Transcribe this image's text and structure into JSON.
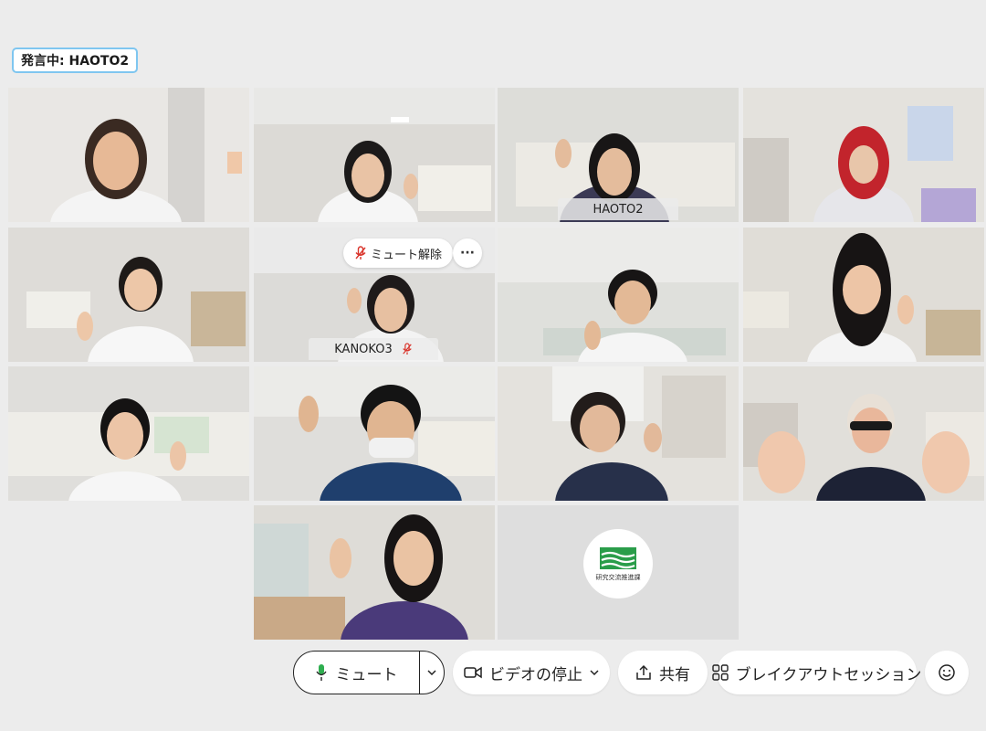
{
  "speaking_indicator": "発言中: HAOTO2",
  "participants": [
    {
      "id": "p1",
      "name": ""
    },
    {
      "id": "p2",
      "name": ""
    },
    {
      "id": "p3",
      "name": "HAOTO2",
      "active_speaker": true
    },
    {
      "id": "p4",
      "name": ""
    },
    {
      "id": "p5",
      "name": ""
    },
    {
      "id": "p6",
      "name": "KANOKO3",
      "muted": true,
      "hover_action": "ミュート解除",
      "more_label": "···"
    },
    {
      "id": "p7",
      "name": ""
    },
    {
      "id": "p8",
      "name": ""
    },
    {
      "id": "p9",
      "name": ""
    },
    {
      "id": "p10",
      "name": ""
    },
    {
      "id": "p11",
      "name": ""
    },
    {
      "id": "p12",
      "name": ""
    },
    {
      "id": "p13",
      "name": ""
    }
  ],
  "logo_tile": {
    "logo_caption": "研究交流推進課",
    "logo_mark": "TUES"
  },
  "toolbar": {
    "mute_label": "ミュート",
    "video_label": "ビデオの停止",
    "share_label": "共有",
    "breakout_label": "ブレイクアウトセッション",
    "icons": [
      "microphone-icon",
      "chevron-down-icon",
      "video-camera-icon",
      "share-upload-icon",
      "breakout-grid-icon",
      "emoji-reaction-icon"
    ]
  },
  "colors": {
    "active_border": "#1da1e6",
    "mic_green": "#2eae4f",
    "muted_red": "#d9342b",
    "logo_green": "#2a9d4a"
  }
}
